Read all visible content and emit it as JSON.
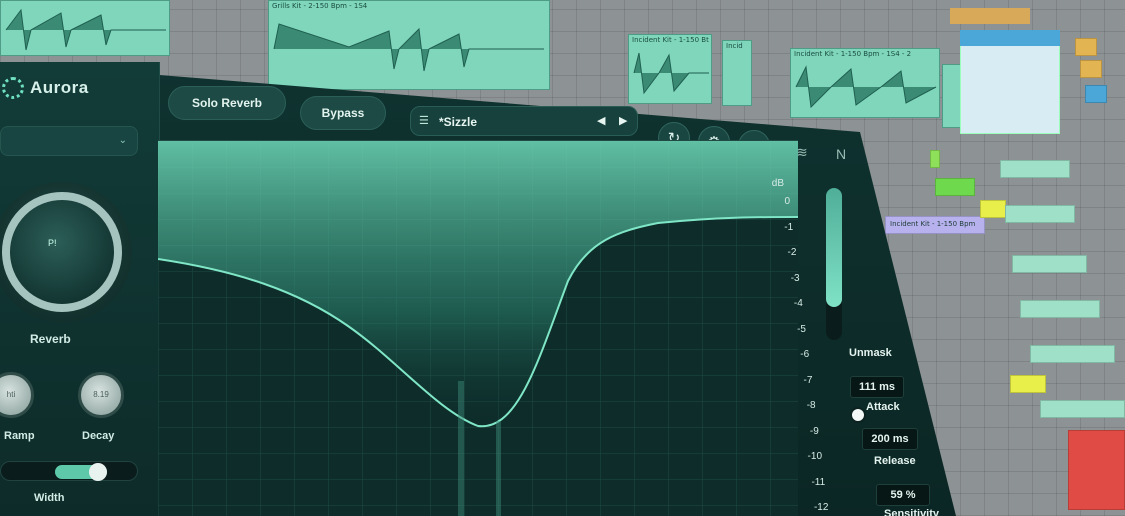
{
  "daw": {
    "clips": [
      {
        "title": ""
      },
      {
        "title": "Grills Kit - 2-150 Bpm - 1S4"
      },
      {
        "title": "Incident Kit - 1-150 Bt"
      },
      {
        "title": "Incid"
      },
      {
        "title": "Incident Kit - 1-150 Bpm - 1S4 - 2"
      },
      {
        "title": ""
      }
    ],
    "side_clip": "Incident Kit - 1-150 Bpm"
  },
  "plugin": {
    "logo": "Aurora",
    "buttons": {
      "solo_reverb": "Solo Reverb",
      "bypass": "Bypass"
    },
    "preset": {
      "name": "*Sizzle",
      "prev_icon": "◀",
      "next_icon": "▶"
    },
    "icons": {
      "history": "history-icon",
      "settings": "gear-icon",
      "help": "?"
    },
    "reverb_knob": {
      "label": "Reverb",
      "value": "P!"
    },
    "small_knobs": [
      {
        "label": "Ramp",
        "value": "hti"
      },
      {
        "label": "Decay",
        "value": "8.19"
      }
    ],
    "width_label": "Width",
    "db_axis": {
      "unit": "dB",
      "ticks": [
        "0",
        "-1",
        "-2",
        "-3",
        "-4",
        "-5",
        "-6",
        "-7",
        "-8",
        "-9",
        "-10",
        "-11",
        "-12"
      ]
    },
    "unmask": {
      "label": "Unmask",
      "level": 0.78
    },
    "attack": {
      "label": "Attack",
      "value": "111 ms"
    },
    "release": {
      "label": "Release",
      "value": "200 ms"
    },
    "sensitivity": {
      "label": "Sensitivity",
      "value": "59 %"
    },
    "accent": "#6fe0c0"
  }
}
